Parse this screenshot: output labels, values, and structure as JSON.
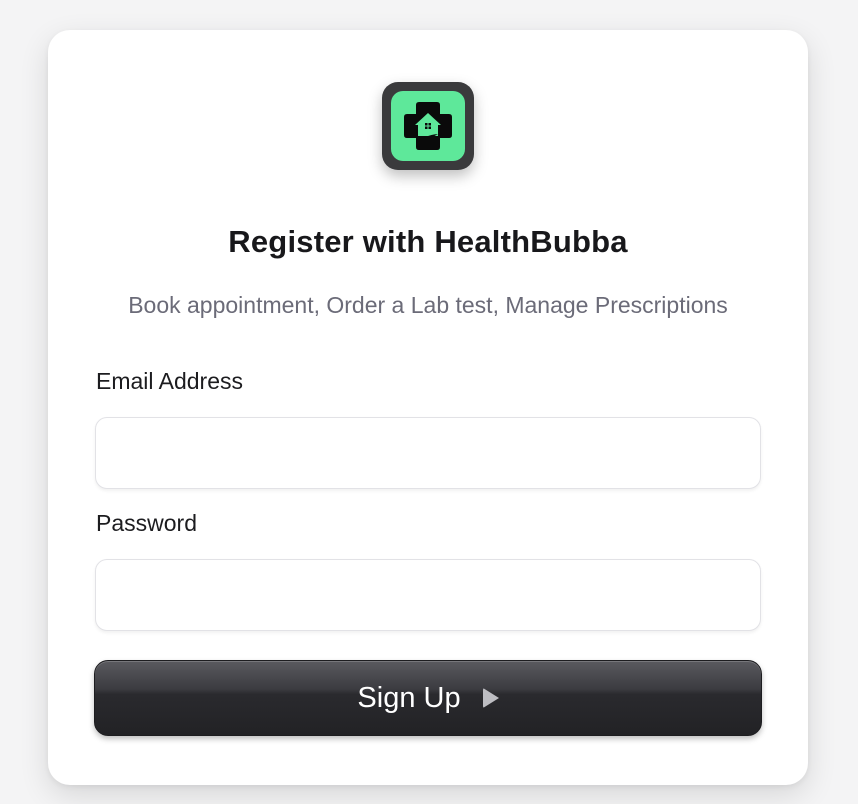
{
  "app": {
    "logo_icon": "medical-cross-house-icon",
    "logo_bg_color": "#5ee89a",
    "logo_frame_color": "#3a3a3c"
  },
  "form": {
    "title": "Register with HealthBubba",
    "subtitle": "Book appointment, Order a Lab test, Manage Prescriptions",
    "email_label": "Email Address",
    "email_value": "",
    "email_placeholder": "",
    "password_label": "Password",
    "password_value": "",
    "password_placeholder": "",
    "submit_label": "Sign Up",
    "submit_icon": "play-icon"
  },
  "colors": {
    "page_bg": "#f4f4f5",
    "card_bg": "#ffffff",
    "button_bg": "#2a2a2e",
    "subtitle_text": "#6b6b78"
  }
}
